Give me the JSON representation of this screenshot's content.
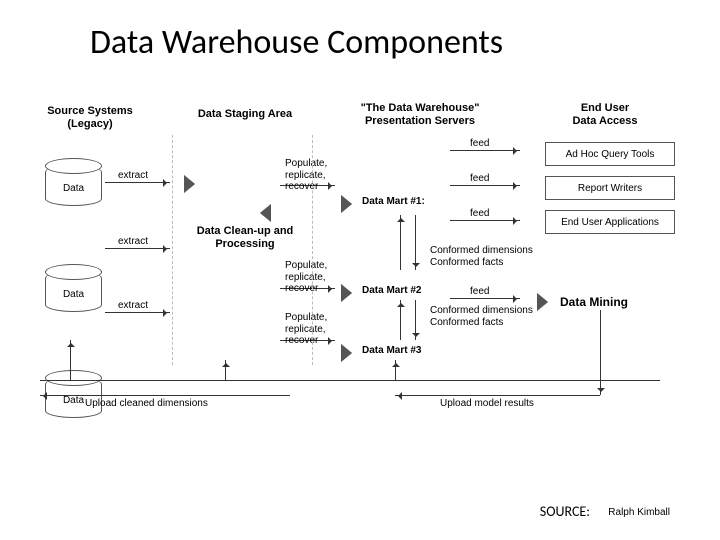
{
  "title": "Data Warehouse Components",
  "columns": {
    "source": "Source Systems\n(Legacy)",
    "staging": "Data Staging Area",
    "dw": "\"The Data Warehouse\"\nPresentation Servers",
    "enduser": "End User\nData Access"
  },
  "source_cyls": [
    "Data",
    "Data",
    "Data"
  ],
  "extract": "extract",
  "cleanup": "Data Clean-up and\nProcessing",
  "populate": "Populate,\nreplicate,\nrecover",
  "marts": [
    "Data Mart #1:",
    "Data Mart #2",
    "Data Mart #3"
  ],
  "feed": "feed",
  "tools": {
    "adhoc": "Ad Hoc Query Tools",
    "report": "Report Writers",
    "euapp": "End User Applications",
    "mining": "Data Mining"
  },
  "conformed": "Conformed dimensions\nConformed facts",
  "upload_dims": "Upload cleaned dimensions",
  "upload_model": "Upload model results",
  "source_label": "SOURCE:",
  "source_author": "Ralph Kimball"
}
